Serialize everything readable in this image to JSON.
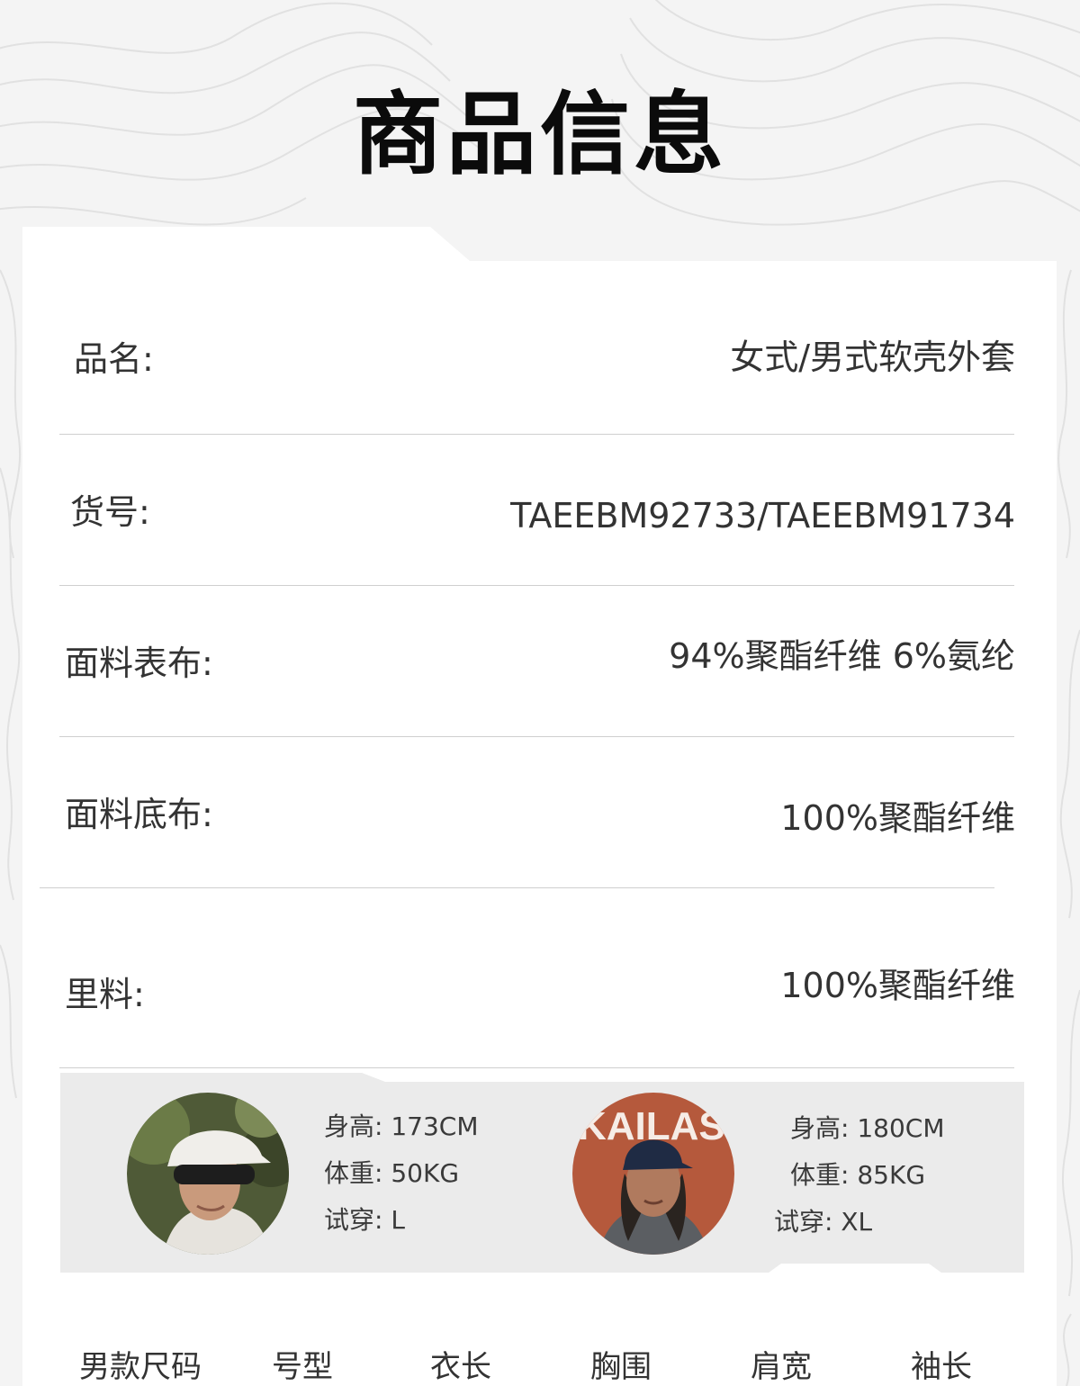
{
  "page_title": "商品信息",
  "product_info": [
    {
      "label": "品名:",
      "value": "女式/男式软壳外套"
    },
    {
      "label": "货号:",
      "value": "TAEEBM92733/TAEEBM91734"
    },
    {
      "label": "面料表布:",
      "value": "94%聚酯纤维 6%氨纶"
    },
    {
      "label": "面料底布:",
      "value": "100%聚酯纤维"
    },
    {
      "label": "里料:",
      "value": "100%聚酯纤维"
    }
  ],
  "models": [
    {
      "height": "身高: 173CM",
      "weight": "体重: 50KG",
      "size": "试穿: L"
    },
    {
      "height": "身高: 180CM",
      "weight": "体重: 85KG",
      "size": "试穿: XL"
    }
  ],
  "avatar_sign_text": "KAILAS",
  "size_table": {
    "headers": [
      "男款尺码",
      "号型",
      "衣长",
      "胸围",
      "肩宽",
      "袖长"
    ]
  }
}
